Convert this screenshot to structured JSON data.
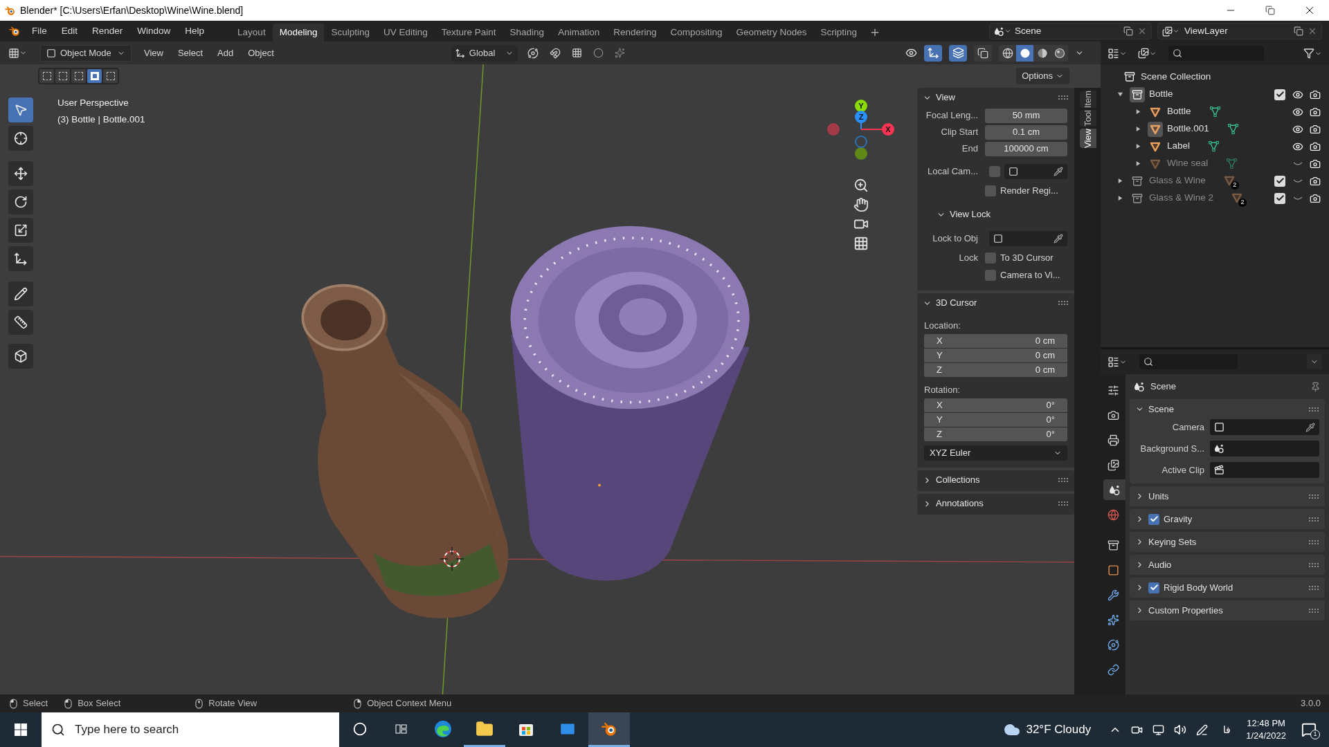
{
  "window": {
    "title": "Blender* [C:\\Users\\Erfan\\Desktop\\Wine\\Wine.blend]"
  },
  "menu": [
    "File",
    "Edit",
    "Render",
    "Window",
    "Help"
  ],
  "workspaces": [
    {
      "label": "Layout",
      "selected": false
    },
    {
      "label": "Modeling",
      "selected": true
    },
    {
      "label": "Sculpting",
      "selected": false
    },
    {
      "label": "UV Editing",
      "selected": false
    },
    {
      "label": "Texture Paint",
      "selected": false
    },
    {
      "label": "Shading",
      "selected": false
    },
    {
      "label": "Animation",
      "selected": false
    },
    {
      "label": "Rendering",
      "selected": false
    },
    {
      "label": "Compositing",
      "selected": false
    },
    {
      "label": "Geometry Nodes",
      "selected": false
    },
    {
      "label": "Scripting",
      "selected": false
    }
  ],
  "scene": "Scene",
  "view_layer": "ViewLayer",
  "viewport": {
    "mode": "Object Mode",
    "menus": [
      "View",
      "Select",
      "Add",
      "Object"
    ],
    "orientation": "Global",
    "options": "Options",
    "toggles": [
      {
        "kind": "gizmo",
        "on": true
      },
      {
        "kind": "overlay",
        "on": true
      },
      {
        "kind": "xray",
        "on": false
      }
    ],
    "shading": [
      {
        "kind": "wireframe",
        "selected": false
      },
      {
        "kind": "solid",
        "selected": true
      },
      {
        "kind": "material",
        "selected": false
      },
      {
        "kind": "rendered",
        "selected": false
      }
    ],
    "select_modes": [
      {
        "selected": false
      },
      {
        "selected": false
      },
      {
        "selected": false
      },
      {
        "selected": true
      },
      {
        "selected": false
      }
    ],
    "overlay_text": [
      "User Perspective",
      "(3) Bottle | Bottle.001"
    ],
    "tools": [
      {
        "kind": "select",
        "selected": true
      },
      {
        "kind": "cursor",
        "selected": false
      },
      {
        "kind": "move",
        "selected": false
      },
      {
        "kind": "rotate",
        "selected": false
      },
      {
        "kind": "scale",
        "selected": false
      },
      {
        "kind": "transform",
        "selected": false
      },
      {
        "kind": "annotate",
        "selected": false
      },
      {
        "kind": "measure",
        "selected": false
      },
      {
        "kind": "add_cube",
        "selected": false
      }
    ],
    "gizmo": {
      "x": "X",
      "y": "Y",
      "z": "Z"
    }
  },
  "sidebar": {
    "tabs": [
      {
        "label": "Item",
        "selected": false
      },
      {
        "label": "Tool",
        "selected": false
      },
      {
        "label": "View",
        "selected": true
      }
    ],
    "panels": [
      {
        "title": "View",
        "expanded": true,
        "rows": [
          {
            "kind": "value",
            "label": "Focal Leng...",
            "value": "50 mm"
          },
          {
            "kind": "value",
            "label": "Clip Start",
            "value": "0.1 cm"
          },
          {
            "kind": "value",
            "label": "End",
            "value": "100000 cm"
          },
          {
            "kind": "picker",
            "label": "Local Cam...",
            "checked": false
          },
          {
            "kind": "check",
            "text": "Render Regi...",
            "checked": false
          },
          {
            "kind": "subheader",
            "title": "View Lock",
            "expanded": true
          },
          {
            "kind": "picker",
            "label": "Lock to Obj"
          },
          {
            "kind": "check",
            "label": "Lock",
            "text": "To 3D Cursor",
            "checked": false
          },
          {
            "kind": "check",
            "text": "Camera to Vi...",
            "checked": false
          }
        ]
      },
      {
        "title": "3D Cursor",
        "expanded": true,
        "rows": [
          {
            "kind": "caption",
            "text": "Location:"
          },
          {
            "kind": "vector",
            "items": [
              {
                "axis": "X",
                "value": "0 cm"
              },
              {
                "axis": "Y",
                "value": "0 cm"
              },
              {
                "axis": "Z",
                "value": "0 cm"
              }
            ]
          },
          {
            "kind": "caption",
            "text": "Rotation:"
          },
          {
            "kind": "vector",
            "items": [
              {
                "axis": "X",
                "value": "0°"
              },
              {
                "axis": "Y",
                "value": "0°"
              },
              {
                "axis": "Z",
                "value": "0°"
              }
            ]
          },
          {
            "kind": "dropdown",
            "value": "XYZ Euler"
          }
        ]
      },
      {
        "title": "Collections",
        "expanded": false
      },
      {
        "title": "Annotations",
        "expanded": false
      }
    ]
  },
  "outliner": {
    "root": "Scene Collection",
    "items": [
      {
        "name": "Bottle",
        "kind": "collection",
        "expanded": true,
        "active": true,
        "included": true,
        "visible": true,
        "children": [
          {
            "name": "Bottle",
            "kind": "mesh",
            "expanded": false,
            "active": false,
            "visible": true
          },
          {
            "name": "Bottle.001",
            "kind": "mesh",
            "expanded": false,
            "active": true,
            "visible": true
          },
          {
            "name": "Label",
            "kind": "mesh",
            "expanded": false,
            "active": false,
            "visible": true
          },
          {
            "name": "Wine seal",
            "kind": "mesh",
            "expanded": false,
            "active": false,
            "visible": false
          }
        ]
      },
      {
        "name": "Glass & Wine",
        "kind": "collection",
        "expanded": false,
        "active": false,
        "included": true,
        "visible": false,
        "count": "2"
      },
      {
        "name": "Glass & Wine 2",
        "kind": "collection",
        "expanded": false,
        "active": false,
        "included": true,
        "visible": false,
        "count": "2"
      }
    ]
  },
  "properties": {
    "tabs": [
      {
        "kind": "tool",
        "selected": false
      },
      {
        "kind": "render",
        "selected": false
      },
      {
        "kind": "output",
        "selected": false
      },
      {
        "kind": "view_layer",
        "selected": false
      },
      {
        "kind": "scene",
        "selected": true
      },
      {
        "kind": "world",
        "selected": false
      },
      {
        "kind": "collection",
        "selected": false
      },
      {
        "kind": "object",
        "selected": false
      },
      {
        "kind": "modifiers",
        "selected": false
      },
      {
        "kind": "particles",
        "selected": false
      },
      {
        "kind": "physics",
        "selected": false
      },
      {
        "kind": "constraints",
        "selected": false
      }
    ],
    "title": "Scene",
    "panels": [
      {
        "title": "Scene",
        "expanded": true,
        "fields": [
          {
            "label": "Camera",
            "kind": "camera"
          },
          {
            "label": "Background S...",
            "kind": "scene"
          },
          {
            "label": "Active Clip",
            "kind": "clip"
          }
        ]
      },
      {
        "title": "Units",
        "expanded": false
      },
      {
        "title": "Gravity",
        "expanded": false,
        "checked": true
      },
      {
        "title": "Keying Sets",
        "expanded": false
      },
      {
        "title": "Audio",
        "expanded": false
      },
      {
        "title": "Rigid Body World",
        "expanded": false,
        "checked": true
      },
      {
        "title": "Custom Properties",
        "expanded": false
      }
    ]
  },
  "status": {
    "hints": [
      {
        "kind": "left",
        "text": "Select"
      },
      {
        "kind": "drag",
        "text": "Box Select"
      },
      {
        "kind": "middle",
        "text": "Rotate View"
      },
      {
        "kind": "right",
        "text": "Object Context Menu"
      }
    ],
    "version": "3.0.0"
  },
  "taskbar": {
    "search_placeholder": "Type here to search",
    "apps": [
      {
        "kind": "cortana",
        "running": false,
        "selected": false
      },
      {
        "kind": "taskview",
        "running": false,
        "selected": false
      },
      {
        "kind": "edge",
        "running": false,
        "selected": false
      },
      {
        "kind": "explorer",
        "running": true,
        "selected": false
      },
      {
        "kind": "store",
        "running": false,
        "selected": false
      },
      {
        "kind": "mail",
        "running": false,
        "selected": false
      },
      {
        "kind": "blender",
        "running": true,
        "selected": true
      }
    ],
    "weather": "32°F Cloudy",
    "ime": "فا",
    "time": "12:48 PM",
    "date": "1/24/2022",
    "notifications": "1"
  }
}
